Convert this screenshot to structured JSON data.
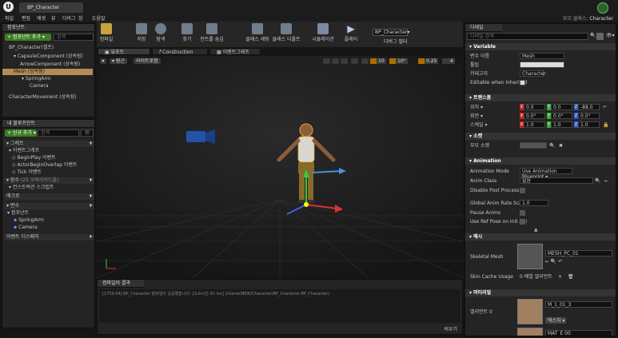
{
  "window": {
    "tab_title": "BP_Character",
    "parent_class_label": "부모 클래스:",
    "parent_class_value": "Character"
  },
  "menu": [
    "파일",
    "편집",
    "애셋",
    "뷰",
    "디버그",
    "창",
    "도움말"
  ],
  "components_panel": {
    "title": "컴포넌트",
    "add_button": "+ 컴포넌트 추가 ▾",
    "search_placeholder": "검색",
    "items": [
      "BP_Character(셀프)",
      "CapsuleComponent (상속됨)",
      "ArrowComponent (상속됨)",
      "Mesh (상속됨)",
      "SpringArm",
      "Camera",
      "CharacterMovement (상속됨)"
    ]
  },
  "mybp_panel": {
    "title": "내 블루프린트",
    "add_button": "+ 신규 추가 ▾",
    "search_placeholder": "검색",
    "sections": {
      "graphs": "그래프",
      "event_graph": "이벤트그래프",
      "functions": "함수",
      "functions_count": "(25 오버라이드블)",
      "macros": "매크로",
      "variables": "변수",
      "components": "컴포넌트",
      "dispatchers": "이벤트 디스패처"
    },
    "events": [
      "BeginPlay 이벤트",
      "ActorBeginOverlap 이벤트",
      "Tick 이벤트"
    ],
    "construction": "컨스트럭션 스크립트",
    "variables": [
      "SpringArm",
      "Camera"
    ]
  },
  "toolbar": [
    {
      "label": "컴파일",
      "icon": "compile-icon"
    },
    {
      "label": "저장",
      "icon": "save-icon"
    },
    {
      "label": "탐색",
      "icon": "browse-icon"
    },
    {
      "label": "찾기",
      "icon": "find-icon"
    },
    {
      "label": "컨트롤 숨김",
      "icon": "hide-unrelated-icon"
    },
    {
      "label": "클래스 세팅",
      "icon": "class-settings-icon"
    },
    {
      "label": "클래스 디폴트",
      "icon": "class-defaults-icon"
    },
    {
      "label": "시뮬레이션",
      "icon": "simulation-icon"
    },
    {
      "label": "플레이",
      "icon": "play-icon"
    }
  ],
  "debug_filter": {
    "value": "BP_Character▾",
    "label": "디버그 필터"
  },
  "editor_tabs": [
    "뷰포트",
    "Construction Script",
    "이벤트그래프"
  ],
  "viewport": {
    "perspective_btn": "▾ 원근",
    "lit_btn": "라이트포함",
    "grid_snap": "10",
    "rot_snap": "10°",
    "scale_snap": "0.25",
    "camera_speed": "4"
  },
  "compiler": {
    "title": "컴파일러 결과",
    "message": "[1759.04] BP_Character 컴파일이 성공했습니다! [소요시간 91 ms] (/Game/NEW/Character/BP_Character.BP_Character)",
    "clear_button": "비우기"
  },
  "details": {
    "title": "디테일",
    "search_placeholder": "디테일 검색",
    "variable_section": "Variable",
    "variable_name_label": "변수 이름",
    "variable_name_value": "Mesh",
    "tooltip_label": "툴팁",
    "category_label": "카테고리",
    "category_value": "Character",
    "editable_label": "Editable when Inherited",
    "transform_section": "트랜스폼",
    "location_label": "위치 ▾",
    "location": [
      "0.0",
      "0.0",
      "-88.0"
    ],
    "rotation_label": "회전 ▾",
    "rotation": [
      "0.0°",
      "0.0°",
      "0.0°"
    ],
    "scale_label": "스케일 ▾",
    "scale": [
      "1.0",
      "1.0",
      "1.0"
    ],
    "sockets_section": "소켓",
    "parent_socket_label": "부모 소켓",
    "animation_section": "Animation",
    "anim_mode_label": "Animation Mode",
    "anim_mode_value": "Use Animation Blueprint ▾",
    "anim_class_label": "Anim Class",
    "anim_class_value": "없음",
    "disable_post_label": "Disable Post Process Bl",
    "global_rate_label": "Global Anim Rate Scale",
    "global_rate_value": "1.0",
    "pause_label": "Pause Anims",
    "ref_pose_label": "Use Ref Pose on Init Ani",
    "mesh_section": "메시",
    "skeletal_mesh_label": "Skeletal Mesh",
    "skeletal_mesh_value": "MESH_PC_01",
    "skin_cache_label": "Skin Cache Usage",
    "skin_cache_value": "0 배열 엘리먼트",
    "materials_section": "머티리얼",
    "element0_label": "엘리먼트 0",
    "element0_value": "M_1_01_3",
    "texture_btn": "텍스처 ▾",
    "element1_value": "MAT_E 00"
  }
}
